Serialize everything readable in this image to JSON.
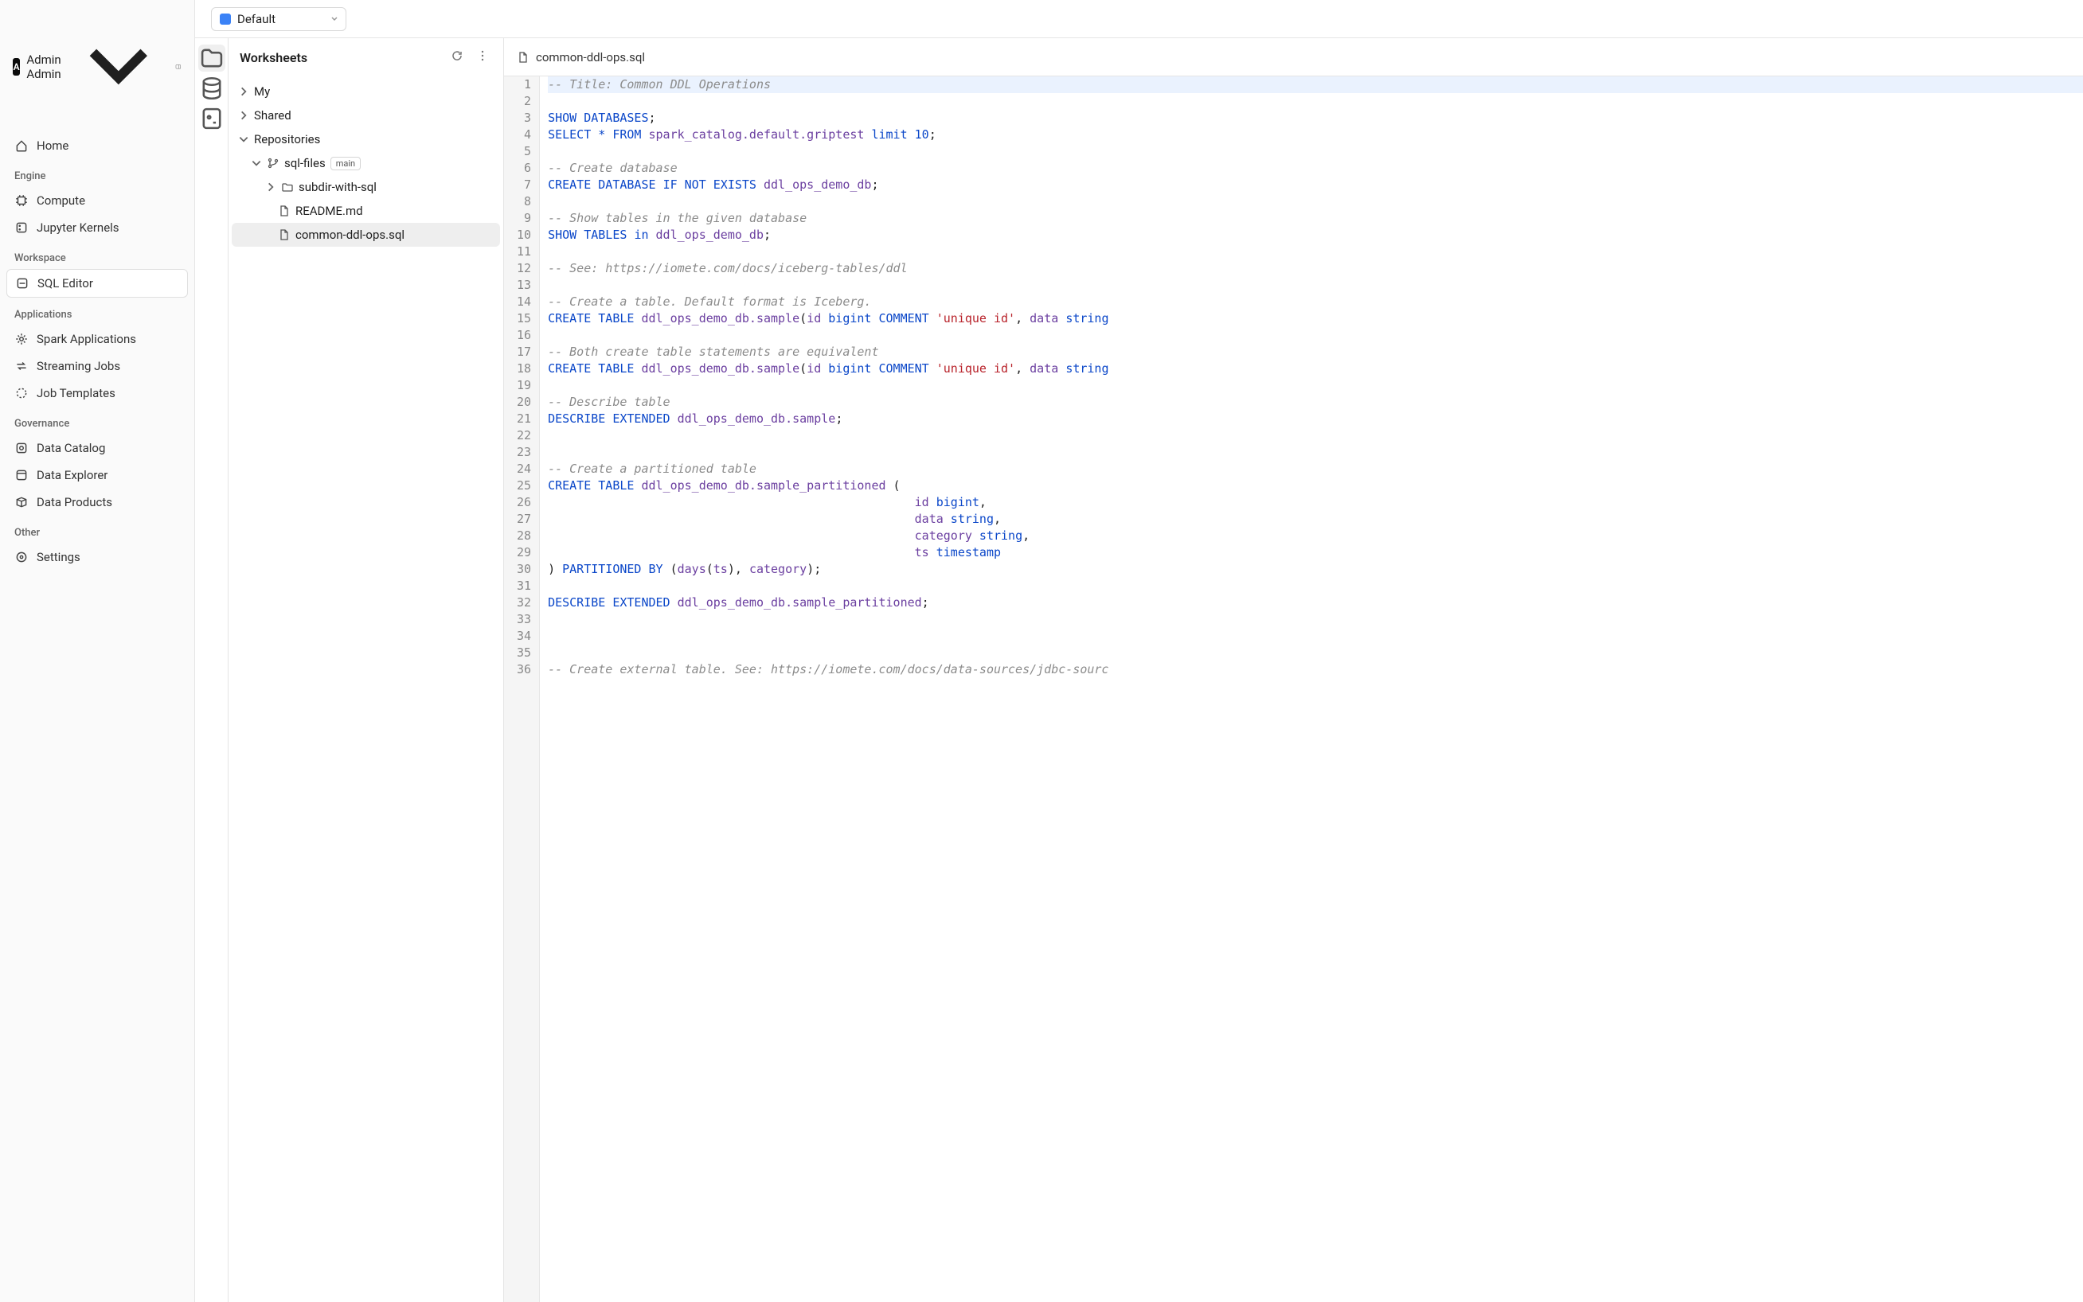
{
  "user": {
    "name": "Admin Admin",
    "avatar_letter": "A"
  },
  "sidebar": {
    "home": "Home",
    "sections": {
      "engine": {
        "title": "Engine",
        "compute": "Compute",
        "jupyter": "Jupyter Kernels"
      },
      "workspace": {
        "title": "Workspace",
        "sql_editor": "SQL Editor"
      },
      "apps": {
        "title": "Applications",
        "spark": "Spark Applications",
        "streaming": "Streaming Jobs",
        "templates": "Job Templates"
      },
      "gov": {
        "title": "Governance",
        "catalog": "Data Catalog",
        "explorer": "Data Explorer",
        "products": "Data Products"
      },
      "other": {
        "title": "Other",
        "settings": "Settings"
      }
    }
  },
  "catalog_select": {
    "label": "Default"
  },
  "worksheets": {
    "title": "Worksheets",
    "tree": {
      "my": "My",
      "shared": "Shared",
      "repositories": "Repositories",
      "repo": {
        "name": "sql-files",
        "branch": "main"
      },
      "subdir": "subdir-with-sql",
      "readme": "README.md",
      "file": "common-ddl-ops.sql"
    }
  },
  "open_file": {
    "name": "common-ddl-ops.sql"
  },
  "code_lines": [
    {
      "n": 1,
      "hl": true,
      "tokens": [
        [
          "com",
          "-- Title: Common DDL Operations"
        ]
      ]
    },
    {
      "n": 2,
      "tokens": []
    },
    {
      "n": 3,
      "tokens": [
        [
          "kw",
          "SHOW"
        ],
        [
          "pn",
          " "
        ],
        [
          "kw",
          "DATABASES"
        ],
        [
          "pn",
          ";"
        ]
      ]
    },
    {
      "n": 4,
      "tokens": [
        [
          "kw",
          "SELECT"
        ],
        [
          "pn",
          " "
        ],
        [
          "sel",
          "*"
        ],
        [
          "pn",
          " "
        ],
        [
          "kw",
          "FROM"
        ],
        [
          "pn",
          " "
        ],
        [
          "id",
          "spark_catalog.default.griptest"
        ],
        [
          "pn",
          " "
        ],
        [
          "kw",
          "limit"
        ],
        [
          "pn",
          " "
        ],
        [
          "num",
          "10"
        ],
        [
          "pn",
          ";"
        ]
      ]
    },
    {
      "n": 5,
      "tokens": []
    },
    {
      "n": 6,
      "tokens": [
        [
          "com",
          "-- Create database"
        ]
      ]
    },
    {
      "n": 7,
      "tokens": [
        [
          "kw",
          "CREATE"
        ],
        [
          "pn",
          " "
        ],
        [
          "kw",
          "DATABASE"
        ],
        [
          "pn",
          " "
        ],
        [
          "kw",
          "IF"
        ],
        [
          "pn",
          " "
        ],
        [
          "kw",
          "NOT"
        ],
        [
          "pn",
          " "
        ],
        [
          "kw",
          "EXISTS"
        ],
        [
          "pn",
          " "
        ],
        [
          "id",
          "ddl_ops_demo_db"
        ],
        [
          "pn",
          ";"
        ]
      ]
    },
    {
      "n": 8,
      "tokens": []
    },
    {
      "n": 9,
      "tokens": [
        [
          "com",
          "-- Show tables in the given database"
        ]
      ]
    },
    {
      "n": 10,
      "tokens": [
        [
          "kw",
          "SHOW"
        ],
        [
          "pn",
          " "
        ],
        [
          "kw",
          "TABLES"
        ],
        [
          "pn",
          " "
        ],
        [
          "kw",
          "in"
        ],
        [
          "pn",
          " "
        ],
        [
          "id",
          "ddl_ops_demo_db"
        ],
        [
          "pn",
          ";"
        ]
      ]
    },
    {
      "n": 11,
      "tokens": []
    },
    {
      "n": 12,
      "tokens": [
        [
          "com",
          "-- See: https://iomete.com/docs/iceberg-tables/ddl"
        ]
      ]
    },
    {
      "n": 13,
      "tokens": []
    },
    {
      "n": 14,
      "tokens": [
        [
          "com",
          "-- Create a table. Default format is Iceberg."
        ]
      ]
    },
    {
      "n": 15,
      "tokens": [
        [
          "kw",
          "CREATE"
        ],
        [
          "pn",
          " "
        ],
        [
          "kw",
          "TABLE"
        ],
        [
          "pn",
          " "
        ],
        [
          "id",
          "ddl_ops_demo_db.sample"
        ],
        [
          "pn",
          "("
        ],
        [
          "id",
          "id"
        ],
        [
          "pn",
          " "
        ],
        [
          "kw",
          "bigint"
        ],
        [
          "pn",
          " "
        ],
        [
          "kw",
          "COMMENT"
        ],
        [
          "pn",
          " "
        ],
        [
          "str",
          "'unique id'"
        ],
        [
          "pn",
          ", "
        ],
        [
          "id",
          "data"
        ],
        [
          "pn",
          " "
        ],
        [
          "kw",
          "string"
        ]
      ]
    },
    {
      "n": 16,
      "tokens": []
    },
    {
      "n": 17,
      "tokens": [
        [
          "com",
          "-- Both create table statements are equivalent"
        ]
      ]
    },
    {
      "n": 18,
      "tokens": [
        [
          "kw",
          "CREATE"
        ],
        [
          "pn",
          " "
        ],
        [
          "kw",
          "TABLE"
        ],
        [
          "pn",
          " "
        ],
        [
          "id",
          "ddl_ops_demo_db.sample"
        ],
        [
          "pn",
          "("
        ],
        [
          "id",
          "id"
        ],
        [
          "pn",
          " "
        ],
        [
          "kw",
          "bigint"
        ],
        [
          "pn",
          " "
        ],
        [
          "kw",
          "COMMENT"
        ],
        [
          "pn",
          " "
        ],
        [
          "str",
          "'unique id'"
        ],
        [
          "pn",
          ", "
        ],
        [
          "id",
          "data"
        ],
        [
          "pn",
          " "
        ],
        [
          "kw",
          "string"
        ]
      ]
    },
    {
      "n": 19,
      "tokens": []
    },
    {
      "n": 20,
      "tokens": [
        [
          "com",
          "-- Describe table"
        ]
      ]
    },
    {
      "n": 21,
      "tokens": [
        [
          "kw",
          "DESCRIBE"
        ],
        [
          "pn",
          " "
        ],
        [
          "kw",
          "EXTENDED"
        ],
        [
          "pn",
          " "
        ],
        [
          "id",
          "ddl_ops_demo_db.sample"
        ],
        [
          "pn",
          ";"
        ]
      ]
    },
    {
      "n": 22,
      "tokens": []
    },
    {
      "n": 23,
      "tokens": []
    },
    {
      "n": 24,
      "tokens": [
        [
          "com",
          "-- Create a partitioned table"
        ]
      ]
    },
    {
      "n": 25,
      "fold": true,
      "tokens": [
        [
          "kw",
          "CREATE"
        ],
        [
          "pn",
          " "
        ],
        [
          "kw",
          "TABLE"
        ],
        [
          "pn",
          " "
        ],
        [
          "id",
          "ddl_ops_demo_db.sample_partitioned"
        ],
        [
          "pn",
          " ("
        ]
      ]
    },
    {
      "n": 26,
      "tokens": [
        [
          "pn",
          "                                                   "
        ],
        [
          "id",
          "id"
        ],
        [
          "pn",
          " "
        ],
        [
          "kw",
          "bigint"
        ],
        [
          "pn",
          ","
        ]
      ]
    },
    {
      "n": 27,
      "tokens": [
        [
          "pn",
          "                                                   "
        ],
        [
          "id",
          "data"
        ],
        [
          "pn",
          " "
        ],
        [
          "kw",
          "string"
        ],
        [
          "pn",
          ","
        ]
      ]
    },
    {
      "n": 28,
      "tokens": [
        [
          "pn",
          "                                                   "
        ],
        [
          "id",
          "category"
        ],
        [
          "pn",
          " "
        ],
        [
          "kw",
          "string"
        ],
        [
          "pn",
          ","
        ]
      ]
    },
    {
      "n": 29,
      "tokens": [
        [
          "pn",
          "                                                   "
        ],
        [
          "id",
          "ts"
        ],
        [
          "pn",
          " "
        ],
        [
          "kw",
          "timestamp"
        ]
      ]
    },
    {
      "n": 30,
      "tokens": [
        [
          "pn",
          ") "
        ],
        [
          "kw",
          "PARTITIONED"
        ],
        [
          "pn",
          " "
        ],
        [
          "kw",
          "BY"
        ],
        [
          "pn",
          " ("
        ],
        [
          "fn",
          "days"
        ],
        [
          "pn",
          "("
        ],
        [
          "id",
          "ts"
        ],
        [
          "pn",
          "), "
        ],
        [
          "id",
          "category"
        ],
        [
          "pn",
          ");"
        ]
      ]
    },
    {
      "n": 31,
      "tokens": []
    },
    {
      "n": 32,
      "tokens": [
        [
          "kw",
          "DESCRIBE"
        ],
        [
          "pn",
          " "
        ],
        [
          "kw",
          "EXTENDED"
        ],
        [
          "pn",
          " "
        ],
        [
          "id",
          "ddl_ops_demo_db.sample_partitioned"
        ],
        [
          "pn",
          ";"
        ]
      ]
    },
    {
      "n": 33,
      "tokens": []
    },
    {
      "n": 34,
      "tokens": []
    },
    {
      "n": 35,
      "tokens": []
    },
    {
      "n": 36,
      "tokens": [
        [
          "com",
          "-- Create external table. See: https://iomete.com/docs/data-sources/jdbc-sourc"
        ]
      ]
    }
  ]
}
